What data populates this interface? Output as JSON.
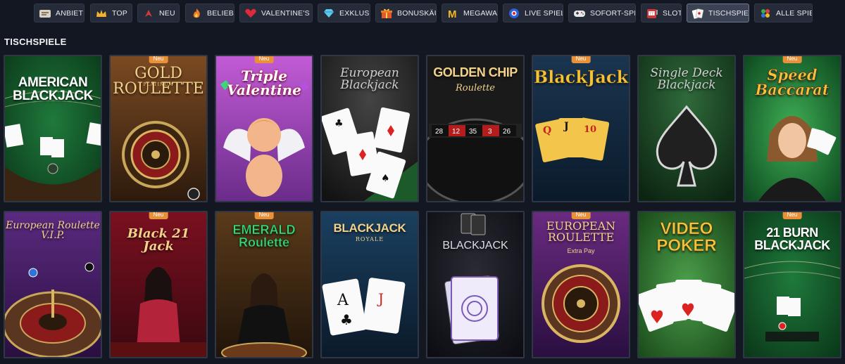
{
  "categories": [
    {
      "label": "ANBIETER",
      "icon": "providers-icon"
    },
    {
      "label": "TOP",
      "icon": "crown-icon"
    },
    {
      "label": "NEU",
      "icon": "new-arrow-icon"
    },
    {
      "label": "BELIEBT",
      "icon": "flame-icon"
    },
    {
      "label": "VALENTINE'S DAY",
      "icon": "heart-icon"
    },
    {
      "label": "EXKLUSIV",
      "icon": "diamond-icon"
    },
    {
      "label": "BONUSKÄUFE",
      "icon": "gift-icon"
    },
    {
      "label": "MEGAWAYS",
      "icon": "megaways-icon"
    },
    {
      "label": "LIVE SPIELE",
      "icon": "live-chip-icon"
    },
    {
      "label": "SOFORT-SPIELE",
      "icon": "gamepad-icon"
    },
    {
      "label": "SLOTS",
      "icon": "slot-machine-icon"
    },
    {
      "label": "TISCHSPIELE",
      "icon": "cards-icon",
      "active": true
    },
    {
      "label": "ALLE SPIELE",
      "icon": "all-games-icon"
    }
  ],
  "section_title": "TISCHSPIELE",
  "badge_new": "Neu",
  "games": [
    {
      "title": "AMERICAN\nBLACKJACK",
      "new": false
    },
    {
      "title": "GOLD\nROULETTE",
      "tag": "PLATINUM",
      "new": true
    },
    {
      "title": "Triple\nValentine",
      "new": true
    },
    {
      "title": "European\nBlackjack",
      "new": false
    },
    {
      "title": "GOLDEN CHIP",
      "sub": "Roulette",
      "new": false
    },
    {
      "title": "BlackJack",
      "new": true
    },
    {
      "title": "Single Deck\nBlackjack",
      "new": false
    },
    {
      "title": "Speed\nBaccarat",
      "new": true
    },
    {
      "title": "European Roulette\nV.I.P.",
      "new": false
    },
    {
      "title": "Black 21 Jack",
      "new": true
    },
    {
      "title": "EMERALD\nRoulette",
      "new": true
    },
    {
      "title": "BLACKJACK",
      "sub": "ROYALE",
      "new": false
    },
    {
      "title": "BLACKJACK",
      "new": false
    },
    {
      "title": "EUROPEAN\nROULETTE",
      "tag": "Extra Pay",
      "new": true
    },
    {
      "title": "VIDEO\nPOKER",
      "new": false
    },
    {
      "title": "21 BURN\nBLACKJACK",
      "new": true
    }
  ],
  "colors": {
    "background": "#121722",
    "badge": "#e8913a",
    "tab_bg": "#252b38"
  }
}
